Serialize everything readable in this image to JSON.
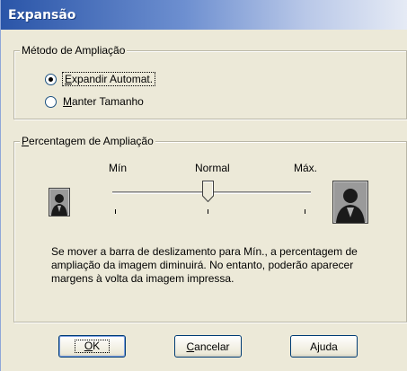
{
  "window": {
    "title": "Expansão"
  },
  "method_group": {
    "label": "Método de Ampliação",
    "options": [
      {
        "label_pre": "",
        "label_ul": "E",
        "label_post": "xpandir Automat.",
        "selected": true
      },
      {
        "label_pre": "",
        "label_ul": "M",
        "label_post": "anter Tamanho",
        "selected": false
      }
    ]
  },
  "percent_group": {
    "label_ul": "P",
    "label_rest": "ercentagem de Ampliação",
    "slider": {
      "min_label": "Mín",
      "mid_label": "Normal",
      "max_label": "Máx.",
      "value": "Normal"
    },
    "small_icon": "person-small-icon",
    "large_icon": "person-large-icon",
    "description": "Se mover a barra de deslizamento para Mín., a percentagem de ampliação da imagem diminuirá. No entanto, poderão aparecer margens à volta da imagem impressa."
  },
  "buttons": {
    "ok": {
      "ul": "O",
      "rest": "K"
    },
    "cancel": {
      "ul": "C",
      "rest": "ancelar"
    },
    "help": {
      "label": "Ajuda"
    }
  }
}
